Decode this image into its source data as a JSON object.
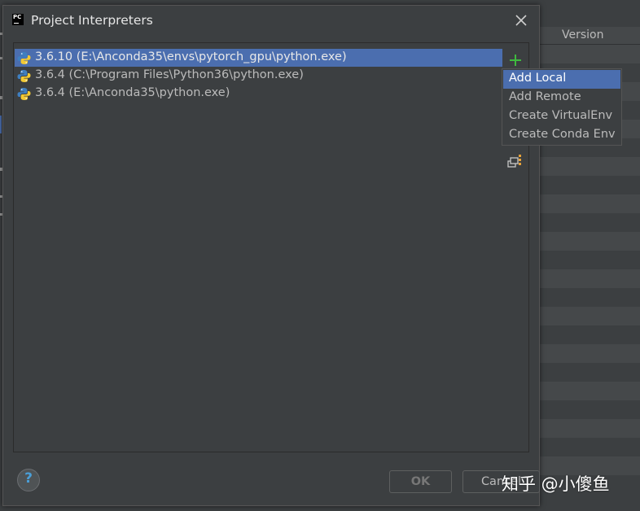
{
  "dialog": {
    "title": "Project Interpreters",
    "app_icon": "pycharm-icon",
    "app_icon_text": "PC"
  },
  "interpreters": [
    {
      "label": "3.6.10 (E:\\Anconda35\\envs\\pytorch_gpu\\python.exe)",
      "selected": true
    },
    {
      "label": "3.6.4 (C:\\Program Files\\Python36\\python.exe)",
      "selected": false
    },
    {
      "label": "3.6.4 (E:\\Anconda35\\python.exe)",
      "selected": false
    }
  ],
  "toolbar": {
    "add_icon": "plus-icon",
    "tree_icon": "interpreter-paths-icon"
  },
  "popup_menu": {
    "items": [
      "Add Local",
      "Add Remote",
      "Create VirtualEnv",
      "Create Conda Env"
    ],
    "selected_index": 0
  },
  "buttons": {
    "ok_label": "OK",
    "cancel_label": "Cancel",
    "help_label": "?"
  },
  "background": {
    "version_header": "Version"
  },
  "watermark": "知乎 @小傻鱼",
  "colors": {
    "selection": "#4b6eaf",
    "plus": "#3fba3f",
    "background": "#3c3f41"
  }
}
